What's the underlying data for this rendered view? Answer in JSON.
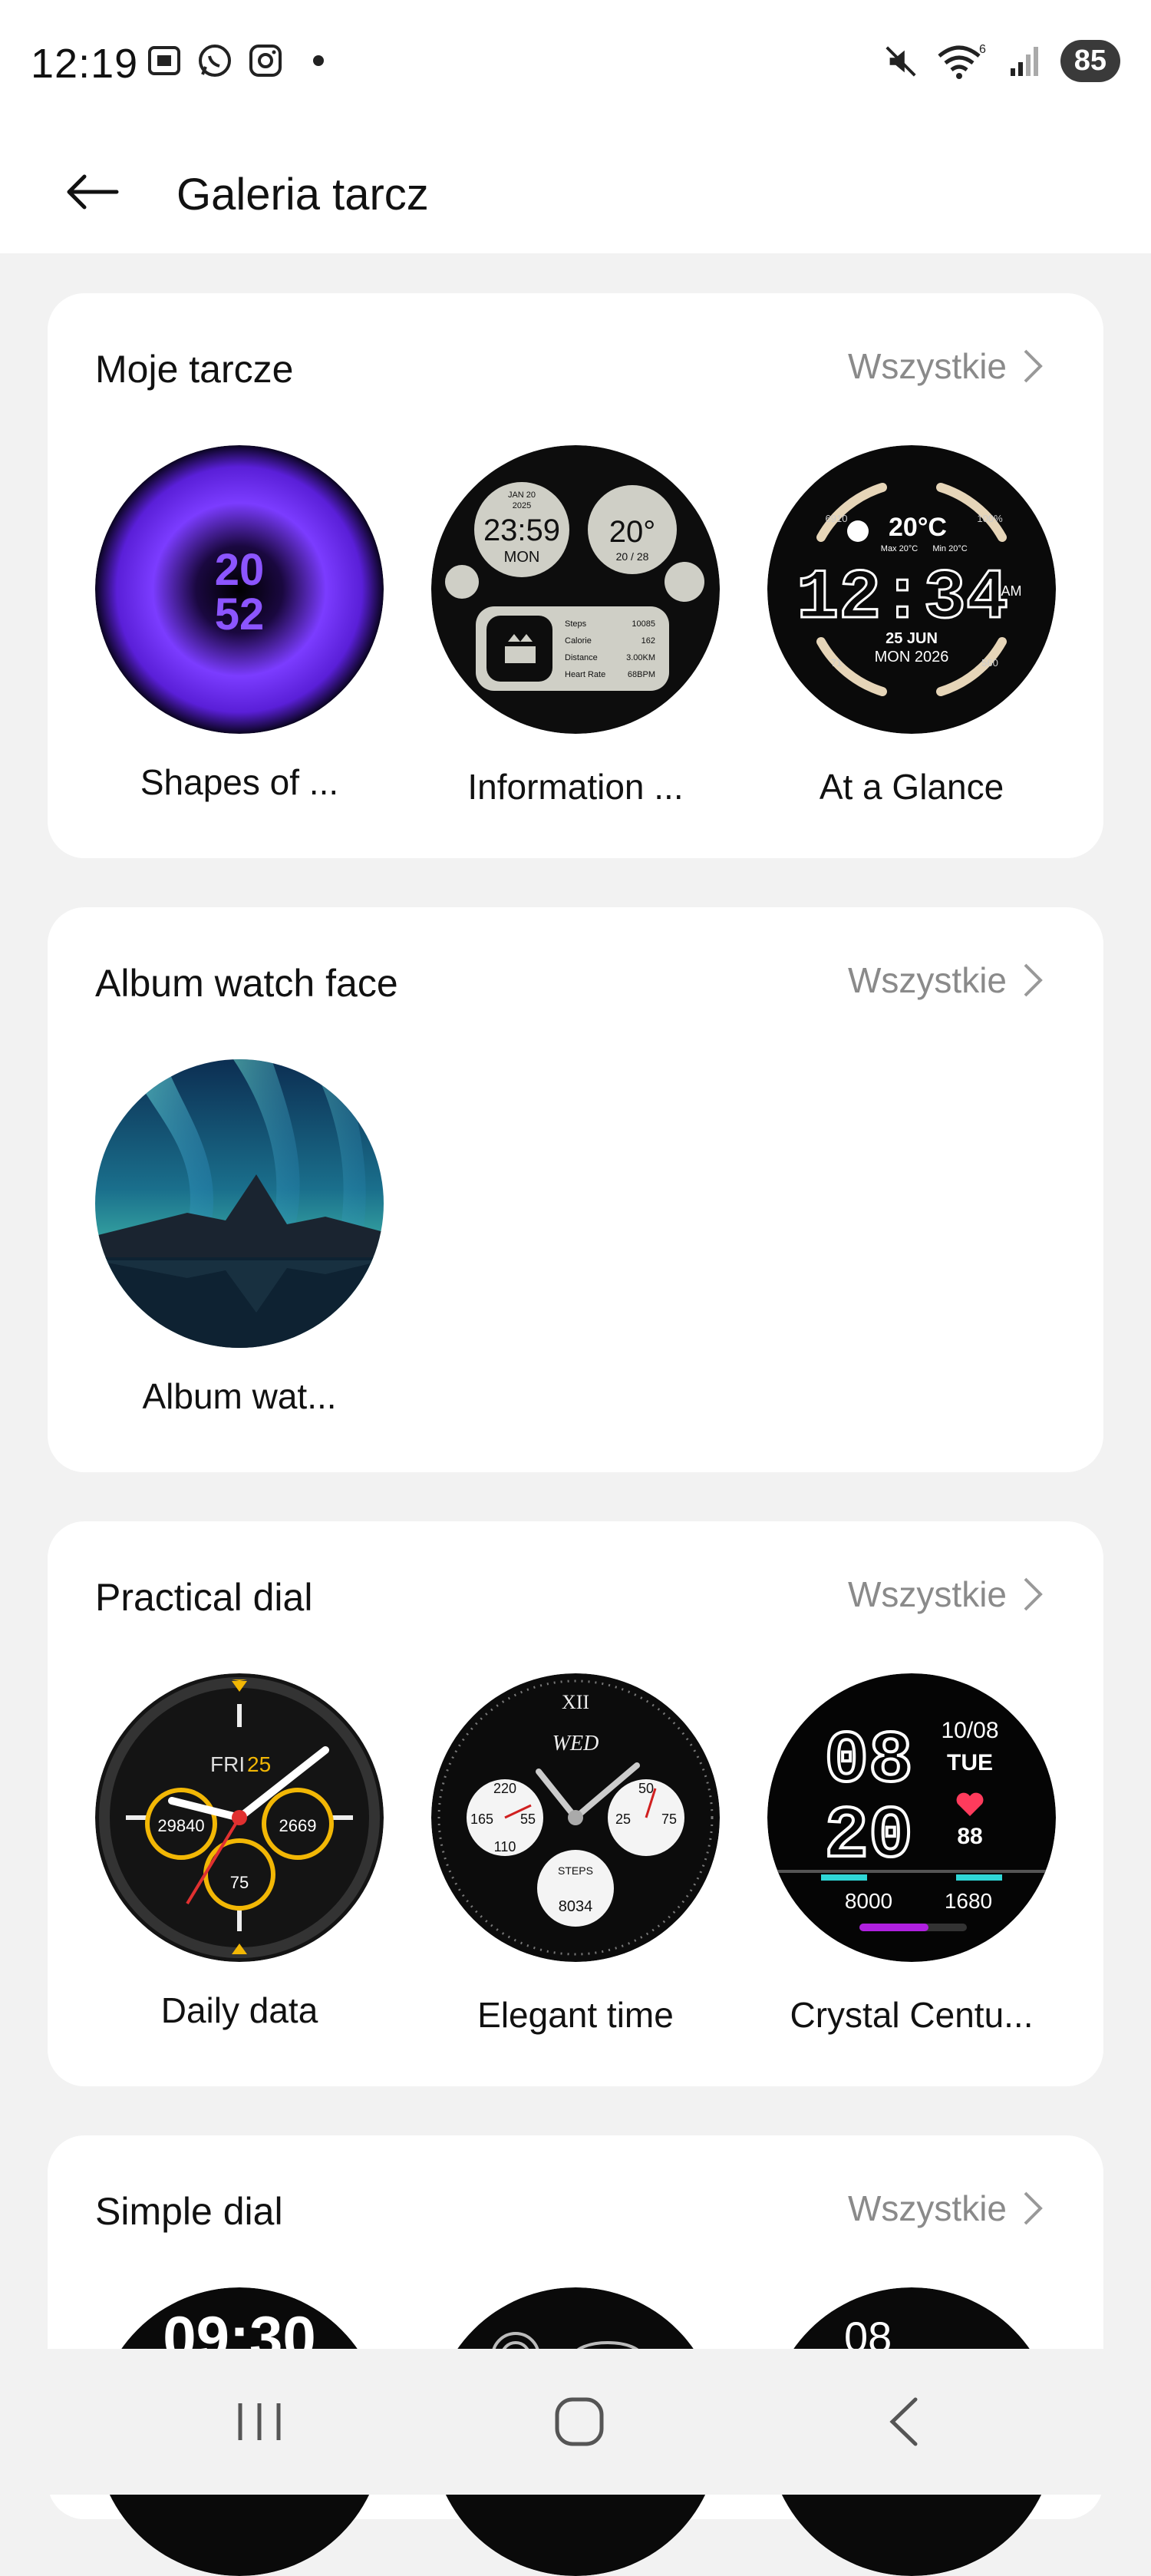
{
  "status_bar": {
    "time": "12:19",
    "battery": "85",
    "wifi_badge": "6"
  },
  "header": {
    "title": "Galeria tarcz"
  },
  "sections": [
    {
      "title": "Moje tarcze",
      "all_label": "Wszystkie",
      "items": [
        {
          "label": "Shapes of ...",
          "face_text": [
            "20",
            "52"
          ]
        },
        {
          "label": "Information ...",
          "face_text": [
            "JAN 20",
            "2025",
            "23:59",
            "MON",
            "20°",
            "20 / 28",
            "Steps",
            "10085",
            "Calorie",
            "162",
            "Distance",
            "3.00KM",
            "Heart Rate",
            "68BPM"
          ]
        },
        {
          "label": "At a Glance",
          "face_text": [
            "20°C",
            "Max 20°C",
            "Min 20°C",
            "12:34",
            "AM",
            "25 JUN",
            "MON 2026",
            "6910",
            "100%",
            "71",
            "560"
          ]
        }
      ]
    },
    {
      "title": "Album watch face",
      "all_label": "Wszystkie",
      "items": [
        {
          "label": "Album wat..."
        }
      ]
    },
    {
      "title": "Practical dial",
      "all_label": "Wszystkie",
      "items": [
        {
          "label": "Daily data",
          "face_text": [
            "FRI",
            "25",
            "29840",
            "2669",
            "75"
          ]
        },
        {
          "label": "Elegant time",
          "face_text": [
            "WED",
            "XII",
            "220",
            "165",
            "55",
            "110",
            "50",
            "25",
            "75",
            "STEPS",
            "8034"
          ]
        },
        {
          "label": "Crystal Centu...",
          "face_text": [
            "08",
            "20",
            "10/08",
            "TUE",
            "88",
            "8000",
            "1680"
          ]
        }
      ]
    },
    {
      "title": "Simple dial",
      "all_label": "Wszystkie",
      "items": [
        {
          "face_text": [
            "09:30"
          ]
        },
        {
          "face_text": []
        },
        {
          "face_text": [
            "08"
          ]
        }
      ]
    }
  ],
  "colors": {
    "accent_purple": "#7b3cff",
    "background": "#f2f2f2",
    "card": "#ffffff",
    "muted_text": "#8a8a8a"
  }
}
